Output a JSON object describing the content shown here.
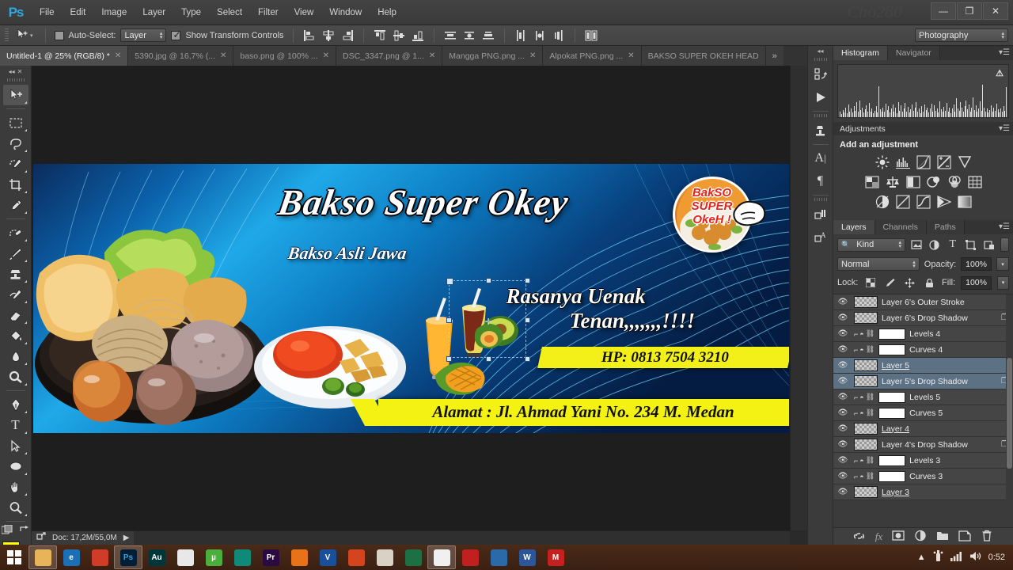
{
  "titlebar": {
    "app_logo": "Ps",
    "watermark": "Cho280",
    "menus": [
      "File",
      "Edit",
      "Image",
      "Layer",
      "Type",
      "Select",
      "Filter",
      "View",
      "Window",
      "Help"
    ],
    "window_controls": [
      {
        "name": "minimize",
        "glyph": "—"
      },
      {
        "name": "restore",
        "glyph": "❐"
      },
      {
        "name": "close",
        "glyph": "✕"
      }
    ]
  },
  "options_bar": {
    "tool_icon": "move-tool-icon",
    "auto_select_label": "Auto-Select:",
    "auto_select_checked": false,
    "auto_select_value": "Layer",
    "show_transform_label": "Show Transform Controls",
    "show_transform_checked": true,
    "align_icons": [
      "align-left-edges-icon",
      "align-horizontal-centers-icon",
      "align-right-edges-icon",
      "align-top-edges-icon",
      "align-vertical-centers-icon",
      "align-bottom-edges-icon",
      "distribute-top-icon",
      "distribute-vertical-center-icon",
      "distribute-bottom-icon",
      "distribute-left-icon",
      "distribute-horizontal-center-icon",
      "distribute-right-icon",
      "auto-align-layers-icon"
    ],
    "workspace": "Photography"
  },
  "tabs": [
    {
      "label": "Untitled-1 @ 25% (RGB/8) *",
      "active": true,
      "closable": true
    },
    {
      "label": "5390.jpg @ 16,7% (...",
      "active": false,
      "closable": true
    },
    {
      "label": "baso.png @ 100% ...",
      "active": false,
      "closable": true
    },
    {
      "label": "DSC_3347.png @ 1...",
      "active": false,
      "closable": true
    },
    {
      "label": "Mangga PNG.png ...",
      "active": false,
      "closable": true
    },
    {
      "label": "Alpokat PNG.png ...",
      "active": false,
      "closable": true
    },
    {
      "label": "BAKSO SUPER OKEH HEAD",
      "active": false,
      "closable": false
    }
  ],
  "tabs_overflow": "»",
  "toolbar": {
    "tools": [
      {
        "name": "move-tool",
        "selected": true,
        "glyph": "move"
      },
      {
        "name": "rectangular-marquee-tool",
        "selected": false,
        "glyph": "marquee"
      },
      {
        "name": "lasso-tool",
        "selected": false,
        "glyph": "lasso"
      },
      {
        "name": "quick-selection-tool",
        "selected": false,
        "glyph": "quickselect"
      },
      {
        "name": "crop-tool",
        "selected": false,
        "glyph": "crop"
      },
      {
        "name": "eyedropper-tool",
        "selected": false,
        "glyph": "eyedropper"
      },
      {
        "name": "spot-healing-brush-tool",
        "selected": false,
        "glyph": "heal"
      },
      {
        "name": "brush-tool",
        "selected": false,
        "glyph": "brush"
      },
      {
        "name": "clone-stamp-tool",
        "selected": false,
        "glyph": "stamp"
      },
      {
        "name": "history-brush-tool",
        "selected": false,
        "glyph": "historybrush"
      },
      {
        "name": "eraser-tool",
        "selected": false,
        "glyph": "eraser"
      },
      {
        "name": "gradient-tool",
        "selected": false,
        "glyph": "paintbucket"
      },
      {
        "name": "blur-tool",
        "selected": false,
        "glyph": "blur"
      },
      {
        "name": "dodge-tool",
        "selected": false,
        "glyph": "dodge"
      },
      {
        "name": "pen-tool",
        "selected": false,
        "glyph": "pen"
      },
      {
        "name": "horizontal-type-tool",
        "selected": false,
        "glyph": "type"
      },
      {
        "name": "path-selection-tool",
        "selected": false,
        "glyph": "pathselect"
      },
      {
        "name": "ellipse-tool",
        "selected": false,
        "glyph": "ellipse"
      },
      {
        "name": "hand-tool",
        "selected": false,
        "glyph": "hand"
      },
      {
        "name": "zoom-tool",
        "selected": false,
        "glyph": "zoom"
      }
    ],
    "foreground_color": "#ffff00",
    "background_color": "#ffffff"
  },
  "dock": {
    "buttons": [
      "history-icon",
      "actions-play-icon",
      "clone-source-icon",
      "character-icon",
      "paragraph-icon",
      "layer-comps-icon",
      "styles-icon"
    ]
  },
  "canvas": {
    "status_doc": "Doc: 17,2M/55,0M",
    "share_icon": "share-icon",
    "play_icon": "status-arrow-icon",
    "banner": {
      "title": "Bakso Super Okey",
      "subtitle": "Bakso Asli Jawa",
      "slogan_line1": "Rasanya Uenak",
      "slogan_line2": "Tenan,,,,,,,!!!!",
      "phone": "HP: 0813 7504 3210",
      "address": "Alamat : Jl. Ahmad Yani No. 234 M. Medan",
      "logo_lines": [
        "BakSO",
        "SUPER",
        "OkeH  !"
      ],
      "phone_bg": "#f2f018",
      "address_bg": "#f4f213",
      "bg_blue": "#1aa7e8"
    }
  },
  "panels": {
    "histogram": {
      "tabs": [
        "Histogram",
        "Navigator"
      ],
      "active_tab": "Histogram",
      "warning_glyph": "⚠",
      "bars": [
        18,
        10,
        22,
        14,
        30,
        12,
        40,
        18,
        26,
        14,
        34,
        20,
        46,
        16,
        52,
        22,
        30,
        14,
        24,
        36,
        18,
        44,
        16,
        28,
        12,
        20,
        34,
        14,
        96,
        24,
        16,
        30,
        18,
        42,
        22,
        34,
        14,
        26,
        40,
        18,
        30,
        12,
        46,
        20,
        36,
        16,
        28,
        44,
        18,
        32,
        14,
        24,
        38,
        20,
        30,
        46,
        16,
        28,
        12,
        34,
        18,
        40,
        22,
        30,
        14,
        26,
        42,
        18,
        36,
        20,
        28,
        14,
        48,
        24,
        16,
        32,
        20,
        44,
        18,
        30,
        12,
        26,
        38,
        16,
        58,
        28,
        20,
        46,
        30,
        18,
        34,
        52,
        24,
        40,
        18,
        30,
        62,
        22,
        36,
        16,
        28,
        48,
        20,
        100,
        30,
        18,
        26,
        14,
        22,
        36,
        16,
        30,
        20,
        42,
        24,
        14,
        28,
        18,
        34,
        20,
        92
      ]
    },
    "adjustments": {
      "title": "Adjustments",
      "subtitle": "Add an adjustment",
      "row1": [
        "brightness-contrast-icon",
        "levels-icon",
        "curves-icon",
        "exposure-icon",
        "vibrance-icon"
      ],
      "row2": [
        "hue-saturation-icon",
        "color-balance-icon",
        "black-white-icon",
        "photo-filter-icon",
        "channel-mixer-icon",
        "color-lookup-icon"
      ],
      "row3": [
        "invert-icon",
        "posterize-icon",
        "threshold-icon",
        "selective-color-icon",
        "gradient-map-icon"
      ]
    },
    "layers": {
      "tabs": [
        "Layers",
        "Channels",
        "Paths"
      ],
      "active_tab": "Layers",
      "filter_kind": "Kind",
      "filter_icons": [
        "filter-pixel-icon",
        "filter-adjustment-icon",
        "filter-type-icon",
        "filter-shape-icon",
        "filter-smart-icon"
      ],
      "blend_mode": "Normal",
      "opacity_label": "Opacity:",
      "opacity_value": "100%",
      "lock_label": "Lock:",
      "lock_icons": [
        "lock-transparent-icon",
        "lock-image-icon",
        "lock-position-icon",
        "lock-all-icon"
      ],
      "fill_label": "Fill:",
      "fill_value": "100%",
      "items": [
        {
          "name": "Layer 6's Outer Stroke",
          "type": "pixel",
          "selected": false,
          "underline": false,
          "fx": false
        },
        {
          "name": "Layer 6's Drop Shadow",
          "type": "pixel",
          "selected": false,
          "underline": false,
          "fx": true
        },
        {
          "name": "Levels 4",
          "type": "adjustment",
          "selected": false,
          "underline": false,
          "fx": false
        },
        {
          "name": "Curves 4",
          "type": "adjustment",
          "selected": false,
          "underline": false,
          "fx": false
        },
        {
          "name": "Layer 5",
          "type": "pixel",
          "selected": true,
          "underline": true,
          "fx": false
        },
        {
          "name": "Layer 5's Drop Shadow",
          "type": "pixel",
          "selected": true,
          "underline": false,
          "fx": true
        },
        {
          "name": "Levels 5",
          "type": "adjustment",
          "selected": false,
          "underline": false,
          "fx": false
        },
        {
          "name": "Curves 5",
          "type": "adjustment",
          "selected": false,
          "underline": false,
          "fx": false
        },
        {
          "name": "Layer 4",
          "type": "pixel",
          "selected": false,
          "underline": true,
          "fx": false
        },
        {
          "name": "Layer 4's Drop Shadow",
          "type": "pixel",
          "selected": false,
          "underline": false,
          "fx": true
        },
        {
          "name": "Levels 3",
          "type": "adjustment",
          "selected": false,
          "underline": false,
          "fx": false
        },
        {
          "name": "Curves 3",
          "type": "adjustment",
          "selected": false,
          "underline": false,
          "fx": false
        },
        {
          "name": "Layer 3",
          "type": "pixel",
          "selected": false,
          "underline": true,
          "fx": false
        }
      ],
      "footer_icons": [
        "link-layers-icon",
        "layer-style-fx-icon",
        "add-mask-icon",
        "new-fill-adjustment-icon",
        "new-group-icon",
        "new-layer-icon",
        "delete-layer-icon"
      ]
    }
  },
  "taskbar": {
    "start_icon": "windows-start-icon",
    "items": [
      {
        "name": "file-explorer",
        "label": "",
        "color": "#e7b45a",
        "active": true
      },
      {
        "name": "internet-explorer",
        "label": "e",
        "color": "#1a6fb5",
        "active": false
      },
      {
        "name": "opera",
        "label": "",
        "color": "#cf3c2a",
        "active": false
      },
      {
        "name": "photoshop",
        "label": "Ps",
        "color": "#001e36",
        "active": true
      },
      {
        "name": "audition",
        "label": "Au",
        "color": "#00363a",
        "active": false
      },
      {
        "name": "notepad",
        "label": "",
        "color": "#e8e8e8",
        "active": false
      },
      {
        "name": "utorrent",
        "label": "µ",
        "color": "#4aaf3c",
        "active": false
      },
      {
        "name": "camtasia",
        "label": "",
        "color": "#0f8a78",
        "active": false
      },
      {
        "name": "premiere",
        "label": "Pr",
        "color": "#2a0a40",
        "active": false
      },
      {
        "name": "vlc",
        "label": "",
        "color": "#e8721a",
        "active": false
      },
      {
        "name": "vegas",
        "label": "V",
        "color": "#1a4f9c",
        "active": false
      },
      {
        "name": "firefox",
        "label": "",
        "color": "#d4451f",
        "active": false
      },
      {
        "name": "calendar",
        "label": "",
        "color": "#d9d2c4",
        "active": false
      },
      {
        "name": "excel",
        "label": "",
        "color": "#1d7044",
        "active": false
      },
      {
        "name": "chrome",
        "label": "",
        "color": "#f0f0f0",
        "active": true
      },
      {
        "name": "avira",
        "label": "",
        "color": "#c02020",
        "active": false
      },
      {
        "name": "media-player",
        "label": "",
        "color": "#2a6aa8",
        "active": false
      },
      {
        "name": "word",
        "label": "W",
        "color": "#2b579a",
        "active": false
      },
      {
        "name": "gmail",
        "label": "M",
        "color": "#c5221f",
        "active": false
      }
    ],
    "tray": {
      "chevron": "▲",
      "icons": [
        "usb-icon",
        "network-signal-icon",
        "volume-icon"
      ],
      "clock": "0:52"
    }
  }
}
